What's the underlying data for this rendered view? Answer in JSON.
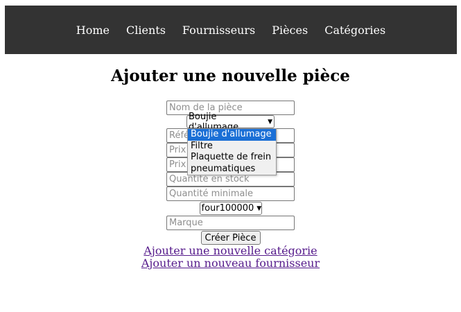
{
  "nav": {
    "items": [
      "Home",
      "Clients",
      "Fournisseurs",
      "Pièces",
      "Catégories"
    ]
  },
  "page": {
    "title": "Ajouter une nouvelle pièce"
  },
  "form": {
    "nom_placeholder": "Nom de la pièce",
    "categorie_selected": "Boujie d'allumage",
    "categorie_options": [
      "Boujie d'allumage",
      "Filtre",
      "Plaquette de frein",
      "pneumatiques"
    ],
    "reference_placeholder": "Référence",
    "prix_achat_placeholder": "Prix d'achat",
    "prix_vente_placeholder": "Prix de vente",
    "quantite_stock_placeholder": "Quantité en stock",
    "quantite_min_placeholder": "Quantité minimale",
    "fournisseur_selected": "four100000",
    "marque_placeholder": "Marque",
    "submit_label": "Créer Pièce"
  },
  "links": {
    "add_category": "Ajouter une nouvelle catégorie",
    "add_supplier": "Ajouter un nouveau fournisseur"
  },
  "colors": {
    "navbar_bg": "#333333",
    "link_visited": "#551a8b",
    "option_highlight": "#1a6fd6"
  },
  "icons": {
    "select_arrow": "chevron-down-icon"
  }
}
